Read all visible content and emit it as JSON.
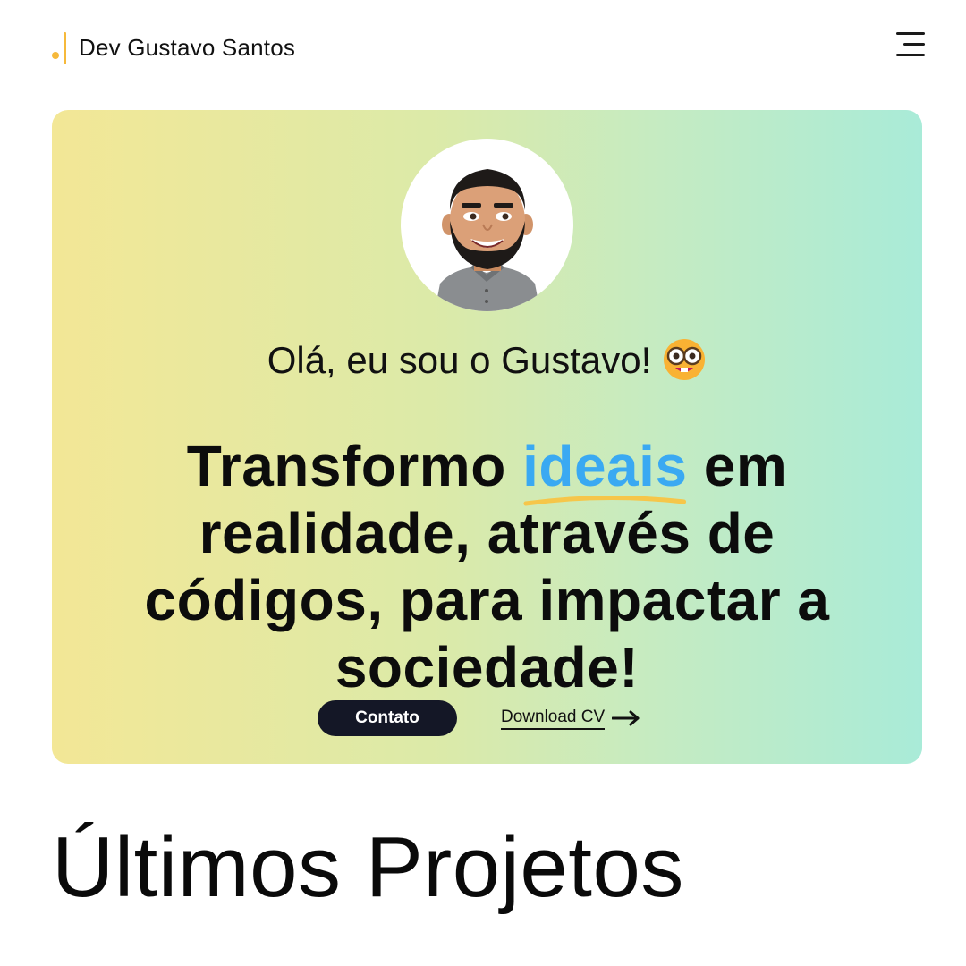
{
  "header": {
    "logo_text": "Dev Gustavo Santos",
    "logo_dot_color": "#f6b93b",
    "logo_bar_color": "#f6b93b",
    "menu_icon": "hamburger-menu-icon"
  },
  "hero": {
    "avatar_icon": "bitmoji-avatar",
    "greeting": "Olá, eu sou o Gustavo!",
    "greeting_emoji": "nerd-face-emoji",
    "headline_before": "Transformo ",
    "headline_highlight": "ideais",
    "headline_after": " em realidade, através de códigos, para impactar a sociedade!",
    "highlight_color": "#3aa9f2",
    "underline_color": "#f6c64a",
    "gradient_start": "#f3e796",
    "gradient_end": "#a9ebd8",
    "contact_button": "Contato",
    "download_link": "Download CV",
    "download_icon": "arrow-right-icon"
  },
  "sections": {
    "latest_projects_title": "Últimos Projetos"
  }
}
